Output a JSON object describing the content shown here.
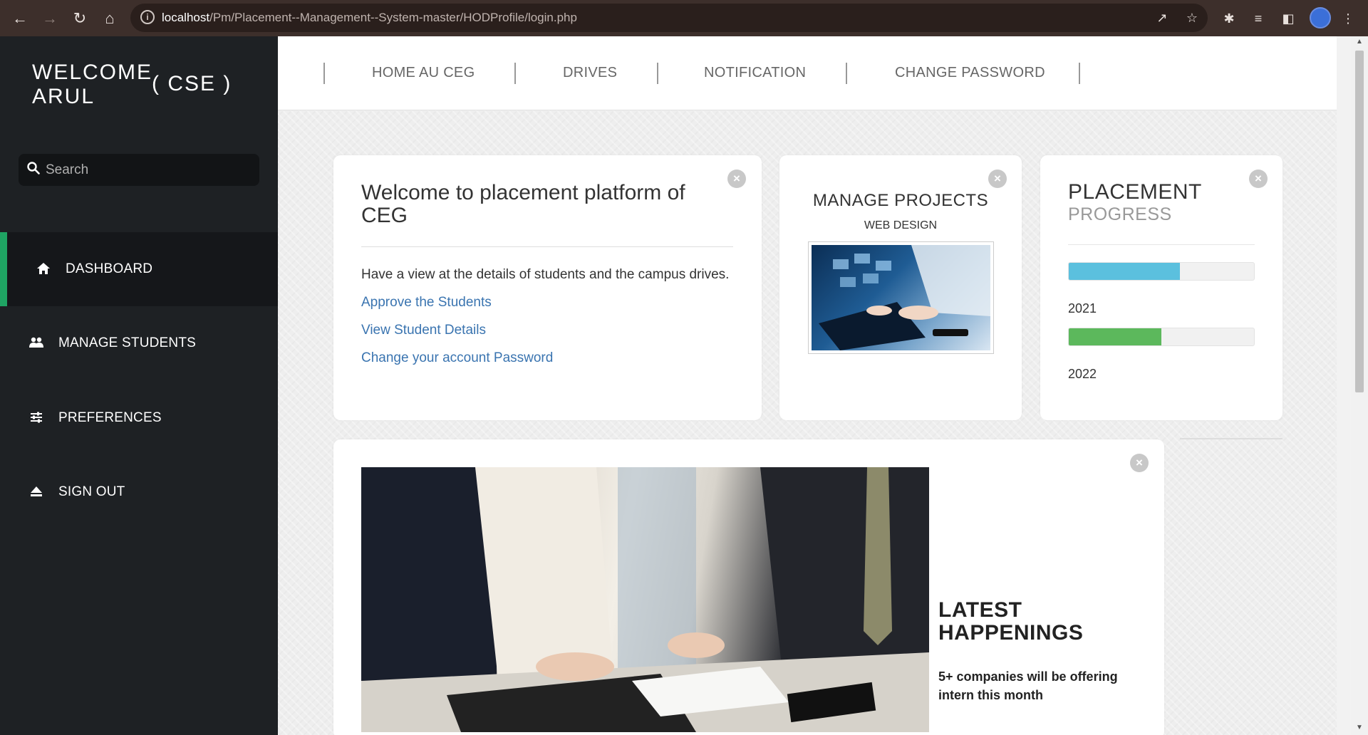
{
  "browser": {
    "url_host": "localhost",
    "url_path": "/Pm/Placement--Management--System-master/HODProfile/login.php"
  },
  "sidebar": {
    "welcome_line1": "WELCOME",
    "welcome_line2": "ARUL",
    "department": "( CSE )",
    "search_placeholder": "Search",
    "items": [
      {
        "label": "DASHBOARD",
        "icon": "home-icon",
        "active": true
      },
      {
        "label": "MANAGE STUDENTS",
        "icon": "users-icon",
        "active": false
      },
      {
        "label": "PREFERENCES",
        "icon": "sliders-icon",
        "active": false
      },
      {
        "label": "SIGN OUT",
        "icon": "eject-icon",
        "active": false
      }
    ]
  },
  "topnav": {
    "links": [
      "HOME AU CEG",
      "DRIVES",
      "NOTIFICATION",
      "CHANGE PASSWORD"
    ]
  },
  "welcome_card": {
    "title": "Welcome to placement platform of CEG",
    "text": "Have a view at the details of students and the campus drives.",
    "links": [
      "Approve the Students",
      "View Student Details",
      "Change your account Password"
    ]
  },
  "projects_card": {
    "title": "MANAGE PROJECTS",
    "subtitle": "WEB DESIGN"
  },
  "progress_card": {
    "title": "PLACEMENT",
    "subtitle": "PROGRESS",
    "bars": [
      {
        "label": "2021",
        "value": 0.6,
        "color": "#5bc0de"
      },
      {
        "label": "2022",
        "value": 0.5,
        "color": "#5cb85c"
      }
    ]
  },
  "news_card": {
    "title": "LATEST HAPPENINGS",
    "text": "5+ companies will be offering intern this month"
  },
  "colors": {
    "sidebar_bg": "#1e2124",
    "active_accent": "#1fa463",
    "link": "#3a74b0"
  }
}
